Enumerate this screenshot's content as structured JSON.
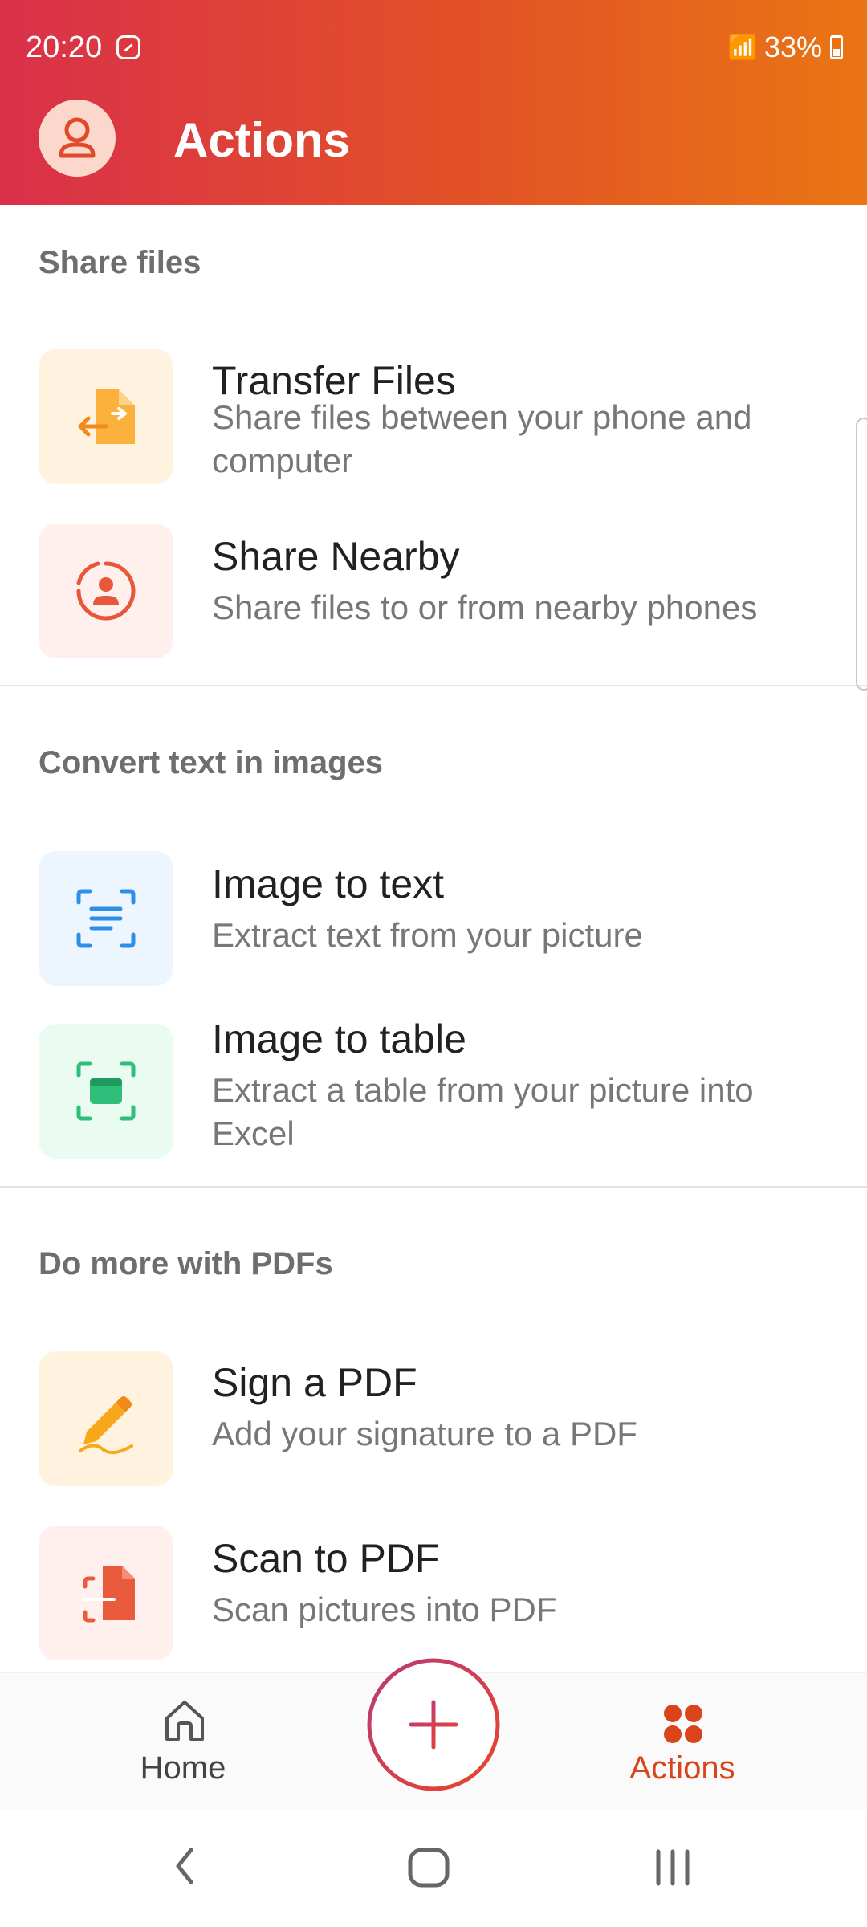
{
  "status_bar": {
    "time": "20:20",
    "battery": "33%",
    "icons": [
      "wifi-calling-icon",
      "call-icon",
      "signal-icon",
      "battery-icon"
    ]
  },
  "header": {
    "title": "Actions",
    "avatar_icon": "person-icon"
  },
  "sections": [
    {
      "title": "Share files",
      "items": [
        {
          "title": "Transfer Files",
          "subtitle": "Share files between your phone and computer",
          "icon": "file-transfer-icon"
        },
        {
          "title": "Share Nearby",
          "subtitle": "Share files to or from nearby phones",
          "icon": "nearby-share-icon"
        }
      ]
    },
    {
      "title": "Convert text in images",
      "items": [
        {
          "title": "Image to text",
          "subtitle": "Extract text from your picture",
          "icon": "scan-text-icon"
        },
        {
          "title": "Image to table",
          "subtitle": "Extract a table from your picture into Excel",
          "icon": "scan-table-icon"
        }
      ]
    },
    {
      "title": "Do more with PDFs",
      "items": [
        {
          "title": "Sign a PDF",
          "subtitle": "Add your signature to a PDF",
          "icon": "signature-pen-icon"
        },
        {
          "title": "Scan to PDF",
          "subtitle": "Scan pictures into PDF",
          "icon": "scan-document-icon"
        }
      ]
    }
  ],
  "bottom_nav": {
    "home_label": "Home",
    "actions_label": "Actions",
    "fab_icon": "plus-icon"
  },
  "colors": {
    "header_start": "#d9304a",
    "header_end": "#ea7514",
    "active_tab": "#d9441b",
    "section_title": "#6e6e6e"
  }
}
